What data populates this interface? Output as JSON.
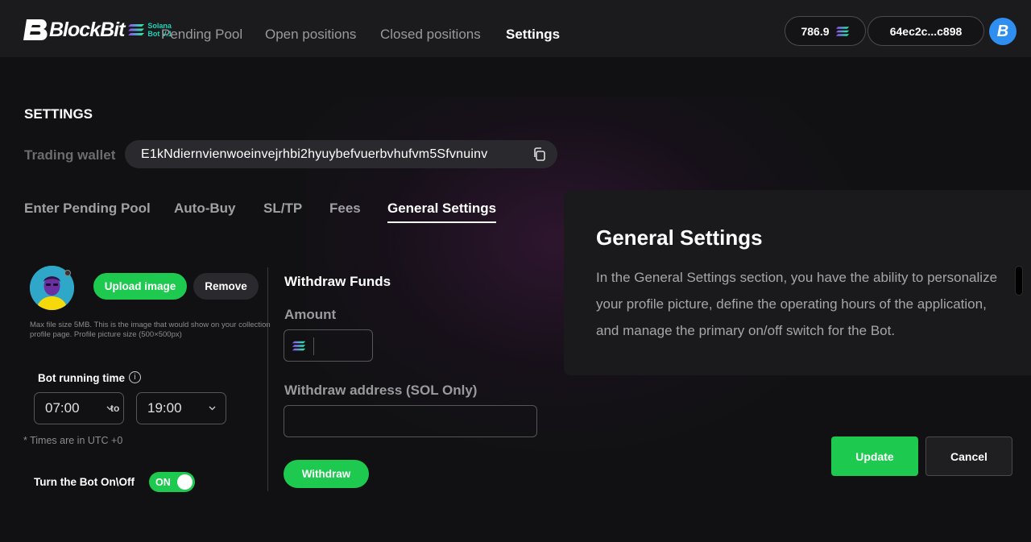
{
  "header": {
    "brand": "BlockBit",
    "brand_sub_line1": "Solana",
    "brand_sub_line2": "Bot V.1",
    "nav": [
      "Pending Pool",
      "Open positions",
      "Closed positions",
      "Settings"
    ],
    "active_nav": "Settings",
    "balance": "786.9",
    "wallet_short": "64ec2c...c898",
    "avatar_letter": "B"
  },
  "settings": {
    "title": "SETTINGS",
    "trading_wallet_label": "Trading wallet",
    "trading_wallet_value": "E1kNdiernvienwoeinvejrhbi2hyuybefvuerbvhufvm5Sfvnuinv",
    "tabs": [
      "Enter Pending Pool",
      "Auto-Buy",
      "SL/TP",
      "Fees",
      "General Settings"
    ],
    "active_tab": "General Settings"
  },
  "profile": {
    "upload_label": "Upload image",
    "remove_label": "Remove",
    "hint": "Max file size 5MB. This is the image that would show on your collection profile page. Profile picture size (500×500px)"
  },
  "bot_time": {
    "label": "Bot running time",
    "start": "07:00",
    "to": "to",
    "end": "19:00",
    "note": "* Times are in UTC +0"
  },
  "bot_switch": {
    "label": "Turn the Bot On\\Off",
    "state": "ON"
  },
  "withdraw": {
    "title": "Withdraw Funds",
    "amount_label": "Amount",
    "address_label": "Withdraw address (SOL Only)",
    "address_value": "",
    "button": "Withdraw"
  },
  "info": {
    "title": "General Settings",
    "body": "In the General Settings section, you have the ability to personalize your profile picture, define the operating hours of the application, and manage the primary on/off switch for the Bot."
  },
  "actions": {
    "update": "Update",
    "cancel": "Cancel"
  },
  "colors": {
    "accent_green": "#1ec950",
    "background": "#111113",
    "brand_blue": "#2f8ff0"
  }
}
